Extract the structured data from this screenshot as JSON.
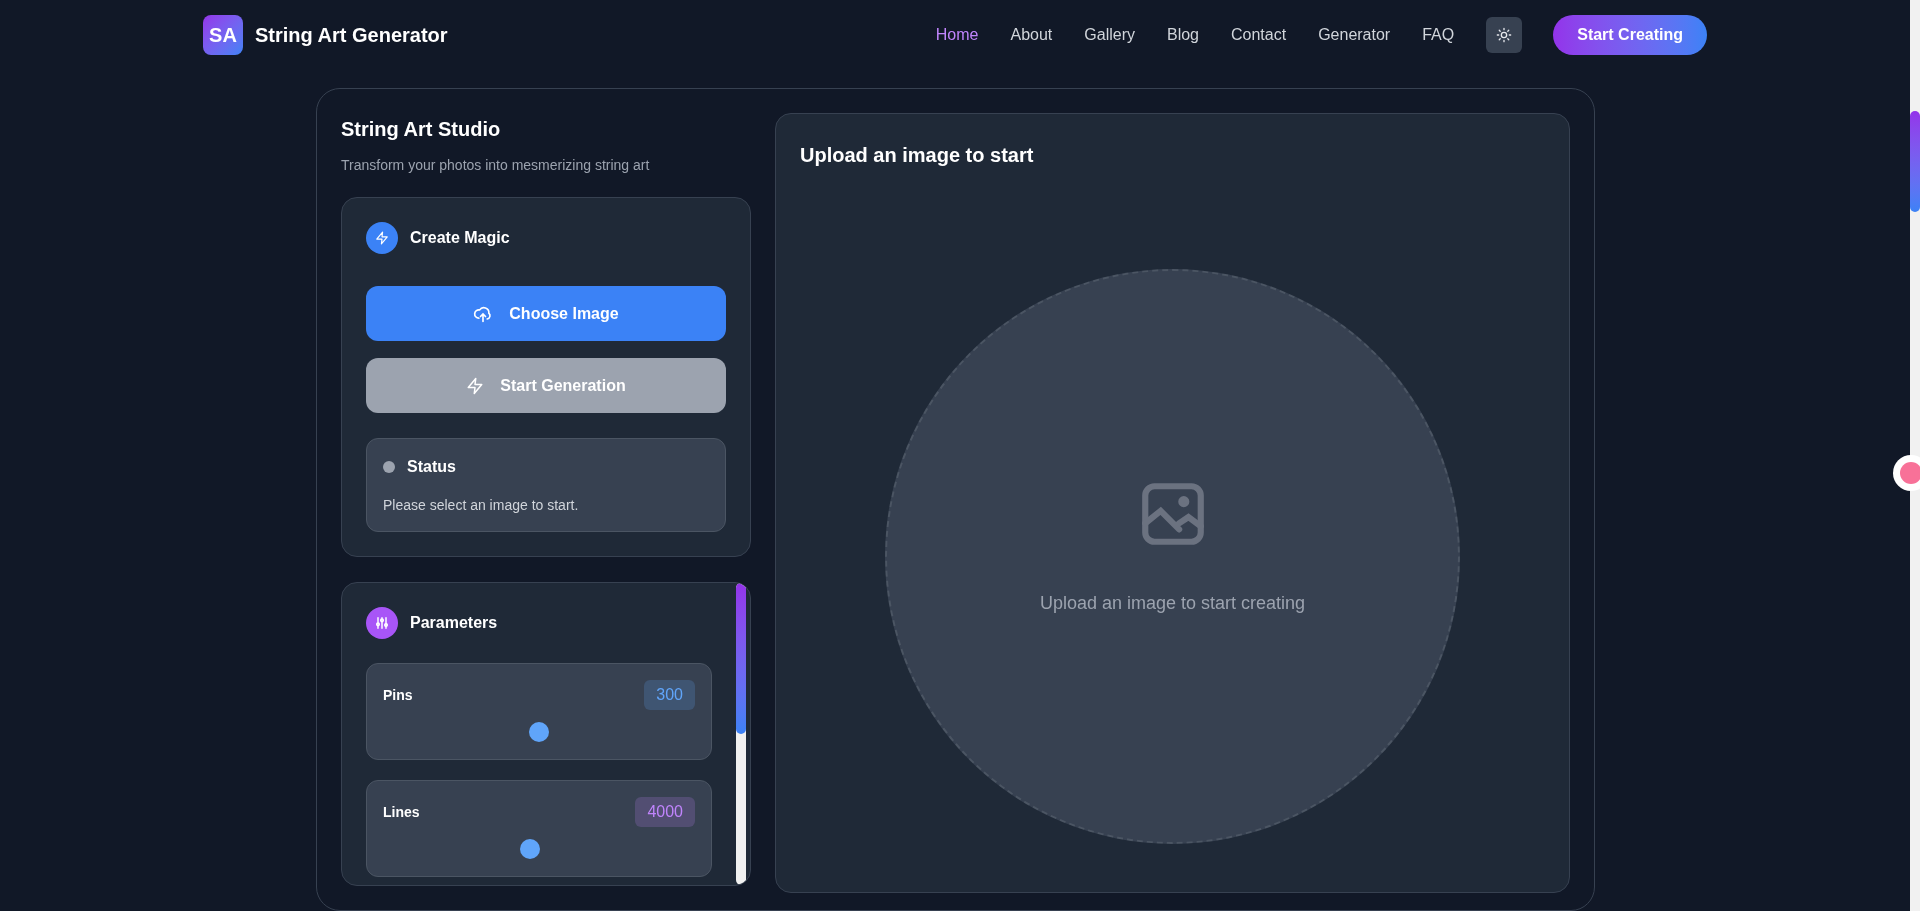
{
  "brand": {
    "logo": "SA",
    "name": "String Art Generator"
  },
  "nav": [
    {
      "label": "Home",
      "selected": true
    },
    {
      "label": "About",
      "selected": false
    },
    {
      "label": "Gallery",
      "selected": false
    },
    {
      "label": "Blog",
      "selected": false
    },
    {
      "label": "Contact",
      "selected": false
    },
    {
      "label": "Generator",
      "selected": false
    },
    {
      "label": "FAQ",
      "selected": false
    }
  ],
  "cta": "Start Creating",
  "studio": {
    "title": "String Art Studio",
    "subtitle": "Transform your photos into mesmerizing string art"
  },
  "create": {
    "title": "Create Magic",
    "choose_button": {
      "label": "Choose Image",
      "disabled": false
    },
    "generate_button": {
      "label": "Start Generation",
      "disabled": true
    },
    "status": {
      "title": "Status",
      "color": "#9ca3af",
      "message": "Please select an image to start."
    }
  },
  "parameters": {
    "title": "Parameters",
    "items": [
      {
        "label": "Pins",
        "value": "300",
        "color": "#60a5fa",
        "level": 0.5
      },
      {
        "label": "Lines",
        "value": "4000",
        "color": "#c084fc",
        "level": 0.47
      }
    ]
  },
  "preview": {
    "title": "Upload an image to start",
    "placeholder": "Upload an image to start creating"
  }
}
